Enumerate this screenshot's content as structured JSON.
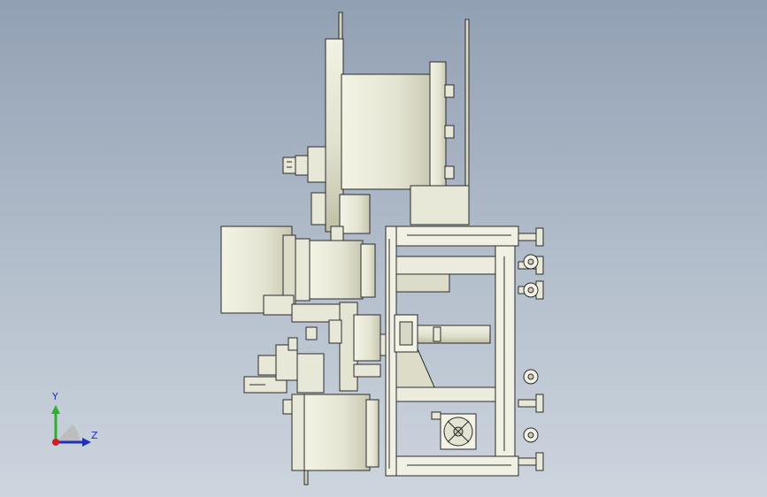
{
  "viewport": {
    "background_top": "#92a0b4",
    "background_bottom": "#cdd5de",
    "part_fill": "#e8e8d8",
    "part_shadow": "#c9c9b2",
    "edge_color": "#2b2b2b"
  },
  "triad": {
    "y_label": "Y",
    "z_label": "Z",
    "y_axis_color": "#2bb02b",
    "z_axis_color": "#1f2fbf",
    "x_axis_color": "#d11f1f",
    "icon": "coordinate-triad-icon"
  }
}
